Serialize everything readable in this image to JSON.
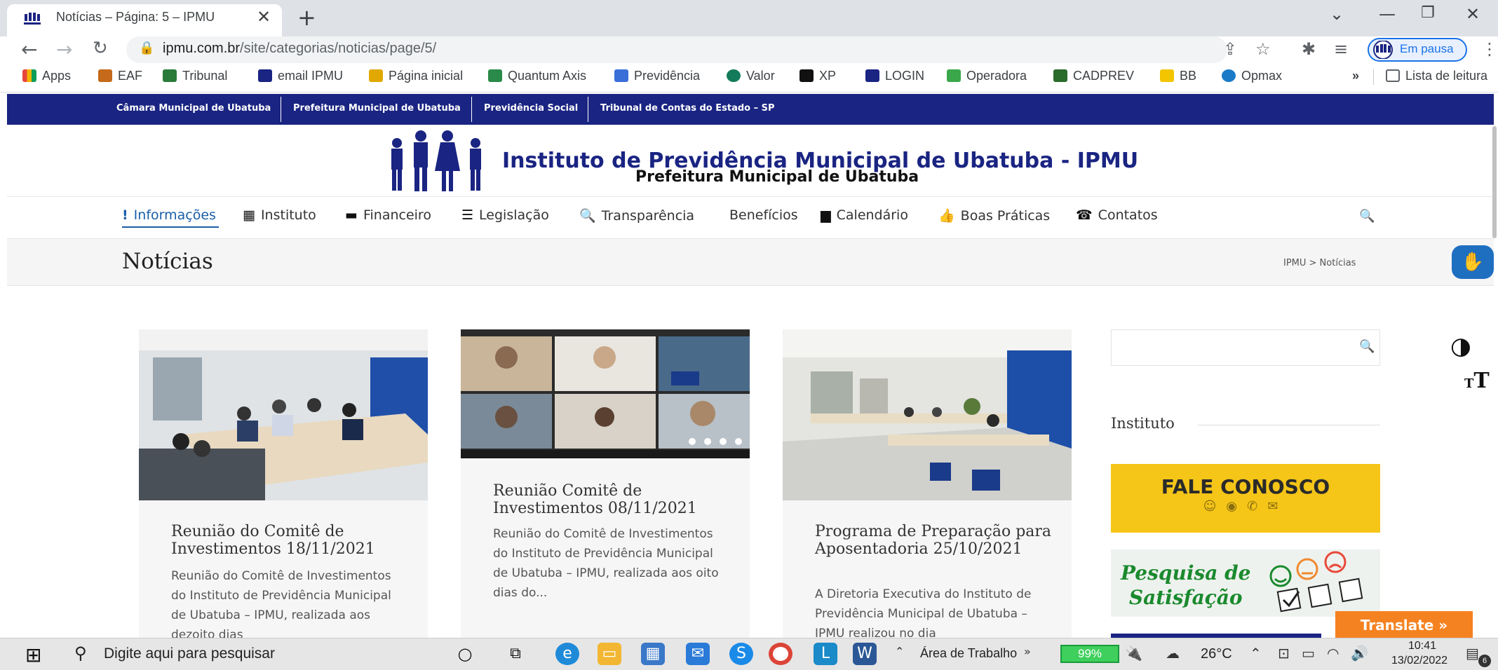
{
  "browser": {
    "tab_title": "Notícias – Página: 5 – IPMU",
    "url_host": "ipmu.com.br",
    "url_path": "/site/categorias/noticias/page/5/",
    "profile_label": "Em pausa",
    "bookmarks": [
      {
        "label": "Apps",
        "color": "#e8453c"
      },
      {
        "label": "EAF",
        "color": "#c46a1a"
      },
      {
        "label": "Tribunal",
        "color": "#2a7a3a"
      },
      {
        "label": "email IPMU",
        "color": "#1a2482"
      },
      {
        "label": "Página inicial",
        "color": "#e0a800"
      },
      {
        "label": "Quantum Axis",
        "color": "#2a8a4a"
      },
      {
        "label": "Previdência",
        "color": "#3a6fd8"
      },
      {
        "label": "Valor",
        "color": "#137a5a"
      },
      {
        "label": "XP",
        "color": "#111111"
      },
      {
        "label": "LOGIN",
        "color": "#1a2482"
      },
      {
        "label": "Operadora",
        "color": "#3aa84a"
      },
      {
        "label": "CADPREV",
        "color": "#2a6a2a"
      },
      {
        "label": "BB",
        "color": "#f2c500"
      },
      {
        "label": "Opmax",
        "color": "#1a7ac8"
      }
    ],
    "reading_list": "Lista de leitura",
    "more_bookmarks": "»"
  },
  "site": {
    "top_links": [
      "Câmara Municipal de Ubatuba",
      "Prefeitura Municipal de Ubatuba",
      "Previdência Social",
      "Tribunal de Contas do Estado – SP"
    ],
    "logo_title": "Instituto de Previdência Municipal de Ubatuba - IPMU",
    "logo_subtitle": "Prefeitura Municipal de Ubatuba",
    "menu": [
      {
        "label": "Informações",
        "icon": "!"
      },
      {
        "label": "Instituto",
        "icon": "▦"
      },
      {
        "label": "Financeiro",
        "icon": "▬"
      },
      {
        "label": "Legislação",
        "icon": "☰"
      },
      {
        "label": "Transparência",
        "icon": "🔍"
      },
      {
        "label": "Benefícios",
        "icon": ""
      },
      {
        "label": "Calendário",
        "icon": "▆"
      },
      {
        "label": "Boas Práticas",
        "icon": "👍"
      },
      {
        "label": "Contatos",
        "icon": "☎"
      }
    ],
    "page_title": "Notícias",
    "breadcrumb": "IPMU > Notícias",
    "cards": [
      {
        "title": "Reunião do Comitê de Investimentos 18/11/2021",
        "excerpt": "Reunião do Comitê de Investimentos do Instituto de Previdência Municipal de Ubatuba – IPMU, realizada aos dezoito dias"
      },
      {
        "title": "Reunião Comitê de Investimentos 08/11/2021",
        "excerpt": "Reunião do Comitê de Investimentos do Instituto de Previdência Municipal de Ubatuba – IPMU, realizada aos oito dias do..."
      },
      {
        "title": "Programa de Preparação para Aposentadoria 25/10/2021",
        "excerpt": "A Diretoria Executiva do Instituto de Previdência Municipal de Ubatuba – IPMU realizou no dia"
      }
    ],
    "sidebar": {
      "heading": "Instituto",
      "fale_conosco": "FALE CONOSCO",
      "pesquisa_line1": "Pesquisa de",
      "pesquisa_line2": "Satisfação"
    },
    "translate_label": "Translate »"
  },
  "taskbar": {
    "search_placeholder": "Digite aqui para pesquisar",
    "desktop_label": "Área de Trabalho",
    "battery": "99%",
    "temperature": "26°C",
    "time": "10:41",
    "date": "13/02/2022",
    "notifications": "6"
  }
}
